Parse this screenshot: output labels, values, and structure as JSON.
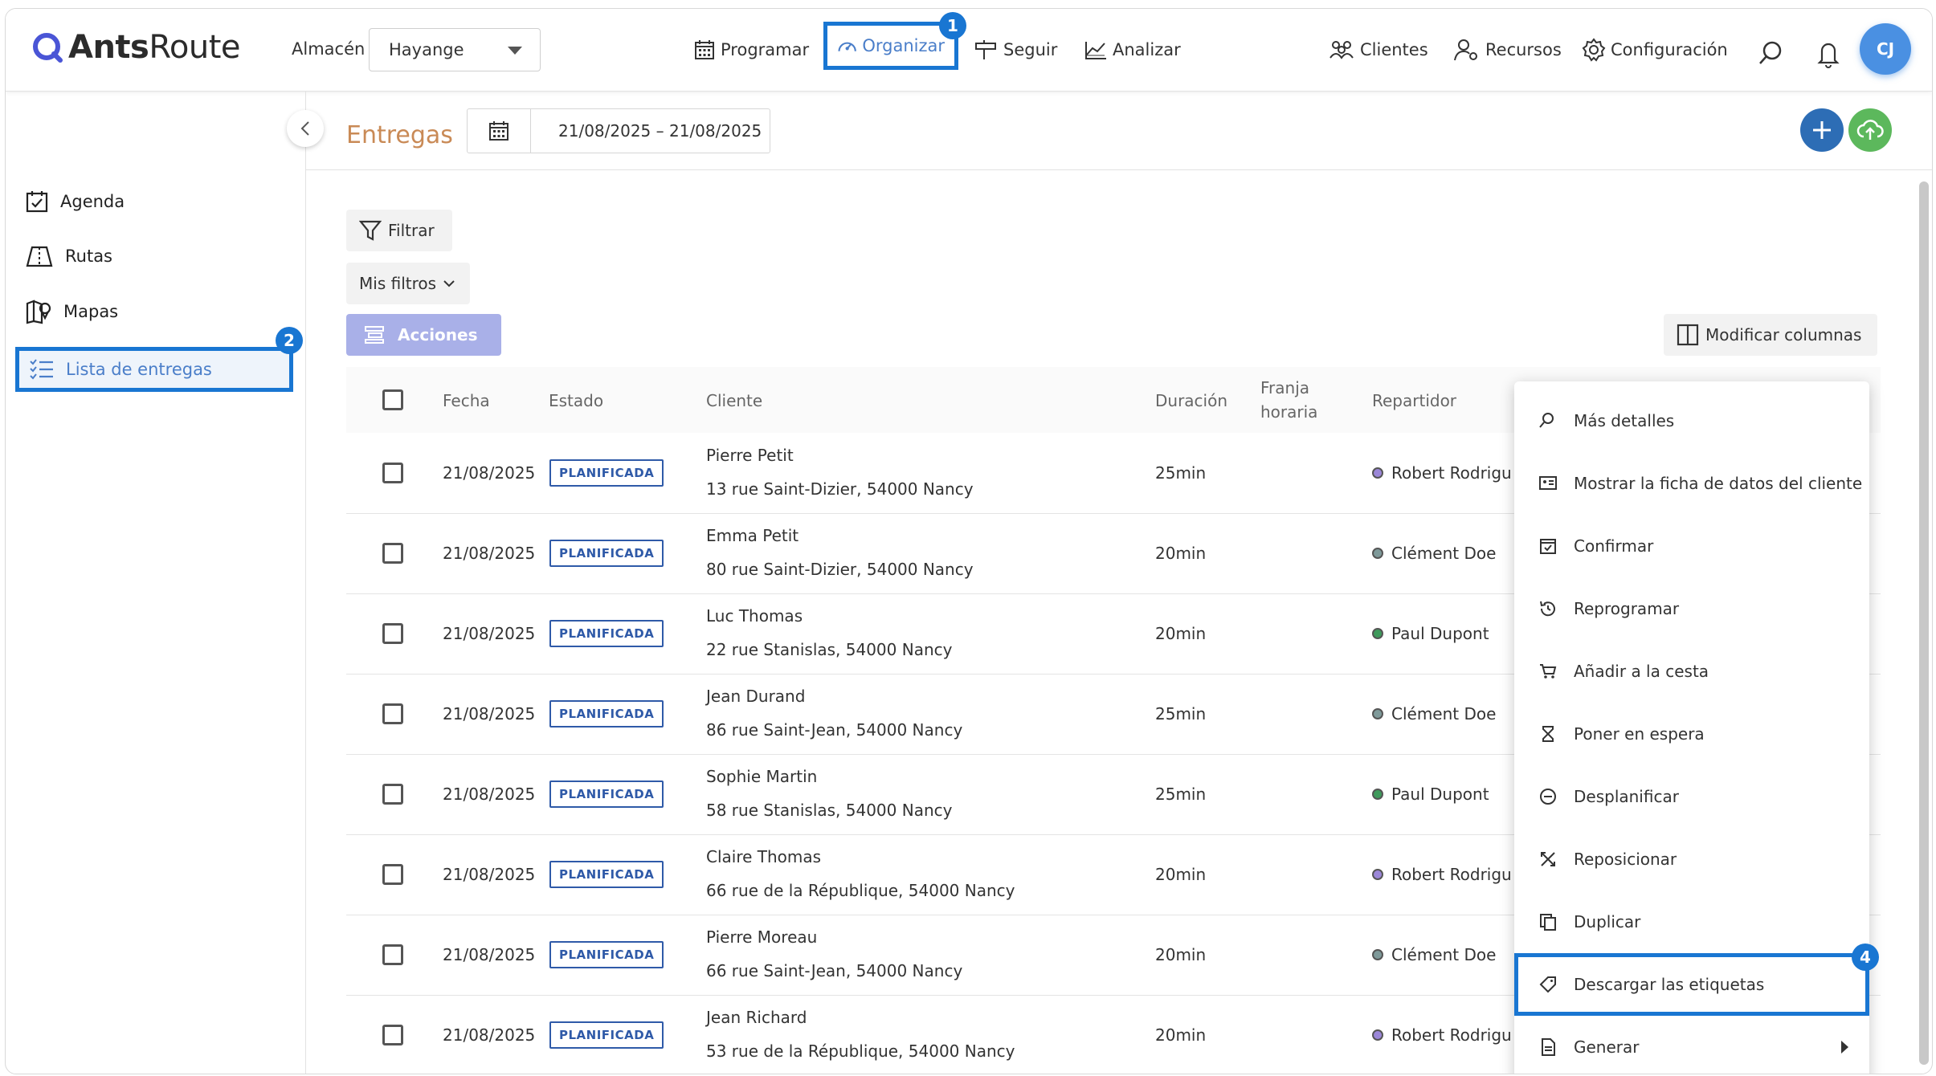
{
  "app": {
    "logo_light": "Ants",
    "logo_bold": "Route"
  },
  "header": {
    "warehouse_label": "Almacén",
    "warehouse_value": "Hayange",
    "nav": [
      {
        "label": "Programar",
        "icon": "calendar-grid-icon"
      },
      {
        "label": "Organizar",
        "icon": "dashboard-gauge-icon",
        "active": true
      },
      {
        "label": "Seguir",
        "icon": "signpost-icon"
      },
      {
        "label": "Analizar",
        "icon": "chart-icon"
      }
    ],
    "right_nav": [
      {
        "label": "Clientes",
        "icon": "clients-icon"
      },
      {
        "label": "Recursos",
        "icon": "resources-icon"
      },
      {
        "label": "Configuración",
        "icon": "gear-icon"
      }
    ],
    "avatar_initials": "CJ"
  },
  "callouts": {
    "one": "1",
    "two": "2",
    "four": "4"
  },
  "sidebar": {
    "items": [
      {
        "label": "Agenda",
        "icon": "agenda-icon"
      },
      {
        "label": "Rutas",
        "icon": "routes-map-icon"
      },
      {
        "label": "Mapas",
        "icon": "map-pin-icon"
      },
      {
        "label": "Lista de entregas",
        "icon": "checklist-icon",
        "active": true
      }
    ]
  },
  "page": {
    "title": "Entregas",
    "date_range": "21/08/2025 – 21/08/2025",
    "filter_label": "Filtrar",
    "my_filters_label": "Mis filtros",
    "actions_label": "Acciones",
    "modify_columns_label": "Modificar columnas"
  },
  "table": {
    "headers": {
      "fecha": "Fecha",
      "estado": "Estado",
      "cliente": "Cliente",
      "duracion": "Duración",
      "franja_1": "Franja",
      "franja_2": "horaria",
      "repartidor": "Repartidor"
    },
    "rows": [
      {
        "fecha": "21/08/2025",
        "estado": "PLANIFICADA",
        "cliente": "Pierre Petit",
        "direccion": "13 rue Saint-Dizier, 54000 Nancy",
        "duracion": "25min",
        "repartidor": "Robert Rodrigu",
        "color": "#9b87d8"
      },
      {
        "fecha": "21/08/2025",
        "estado": "PLANIFICADA",
        "cliente": "Emma Petit",
        "direccion": "80 rue Saint-Dizier, 54000 Nancy",
        "duracion": "20min",
        "repartidor": "Clément Doe",
        "color": "#7f9a9a"
      },
      {
        "fecha": "21/08/2025",
        "estado": "PLANIFICADA",
        "cliente": "Luc Thomas",
        "direccion": "22 rue Stanislas, 54000 Nancy",
        "duracion": "20min",
        "repartidor": "Paul Dupont",
        "color": "#3f9a5c"
      },
      {
        "fecha": "21/08/2025",
        "estado": "PLANIFICADA",
        "cliente": "Jean Durand",
        "direccion": "86 rue Saint-Jean, 54000 Nancy",
        "duracion": "25min",
        "repartidor": "Clément Doe",
        "color": "#7f9a9a"
      },
      {
        "fecha": "21/08/2025",
        "estado": "PLANIFICADA",
        "cliente": "Sophie Martin",
        "direccion": "58 rue Stanislas, 54000 Nancy",
        "duracion": "25min",
        "repartidor": "Paul Dupont",
        "color": "#3f9a5c"
      },
      {
        "fecha": "21/08/2025",
        "estado": "PLANIFICADA",
        "cliente": "Claire Thomas",
        "direccion": "66 rue de la République, 54000 Nancy",
        "duracion": "20min",
        "repartidor": "Robert Rodrigu",
        "color": "#9b87d8"
      },
      {
        "fecha": "21/08/2025",
        "estado": "PLANIFICADA",
        "cliente": "Pierre Moreau",
        "direccion": "66 rue Saint-Jean, 54000 Nancy",
        "duracion": "20min",
        "repartidor": "Clément Doe",
        "color": "#7f9a9a"
      },
      {
        "fecha": "21/08/2025",
        "estado": "PLANIFICADA",
        "cliente": "Jean Richard",
        "direccion": "53 rue de la République, 54000 Nancy",
        "duracion": "20min",
        "repartidor": "Robert Rodrigu",
        "color": "#9b87d8"
      }
    ]
  },
  "context_menu": {
    "items": [
      {
        "label": "Más detalles",
        "icon": "search-details-icon"
      },
      {
        "label": "Mostrar la ficha de datos del cliente",
        "icon": "id-card-icon"
      },
      {
        "label": "Confirmar",
        "icon": "calendar-check-icon"
      },
      {
        "label": "Reprogramar",
        "icon": "history-icon"
      },
      {
        "label": "Añadir a la cesta",
        "icon": "cart-icon"
      },
      {
        "label": "Poner en espera",
        "icon": "hourglass-icon"
      },
      {
        "label": "Desplanificar",
        "icon": "minus-circle-icon"
      },
      {
        "label": "Reposicionar",
        "icon": "reposition-icon"
      },
      {
        "label": "Duplicar",
        "icon": "copy-icon"
      },
      {
        "label": "Descargar las etiquetas",
        "icon": "tag-icon",
        "highlighted": true
      },
      {
        "label": "Generar",
        "icon": "document-icon",
        "submenu": true
      }
    ]
  },
  "colors": {
    "accent": "#1976d2",
    "title": "#c98a56",
    "add_button": "#2d6db5",
    "upload_button": "#5cb85c"
  }
}
